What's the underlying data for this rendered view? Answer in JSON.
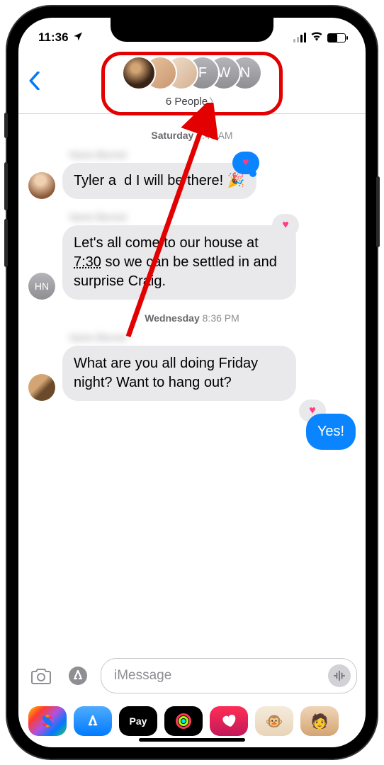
{
  "status": {
    "time": "11:36",
    "location_icon": "✈"
  },
  "nav": {
    "group_label": "6 People",
    "avatars": {
      "init1": "F",
      "init2": "W",
      "init3": "N"
    }
  },
  "timestamps": {
    "t1_day": "Saturday",
    "t1_time": "7:43 AM",
    "t2_day": "Wednesday",
    "t2_time": "8:36 PM"
  },
  "messages": {
    "m1_sender": "Name Blurred",
    "m1_text_a": "Tyler a",
    "m1_text_b": "d I will be there!",
    "m1_emoji": "🎉",
    "m2_sender": "Name Blurred",
    "m2_text_a": "Let's all come to our house at ",
    "m2_time": "7:30",
    "m2_text_b": " so we can be settled in and surprise Craig.",
    "m2_avatar_initials": "HN",
    "m3_sender": "Name Blurred",
    "m3_text": "What are you all doing Friday night? Want to hang out?",
    "m4_text": "Yes!"
  },
  "compose": {
    "placeholder": "iMessage"
  },
  "apps": {
    "pay_label": "Pay"
  }
}
